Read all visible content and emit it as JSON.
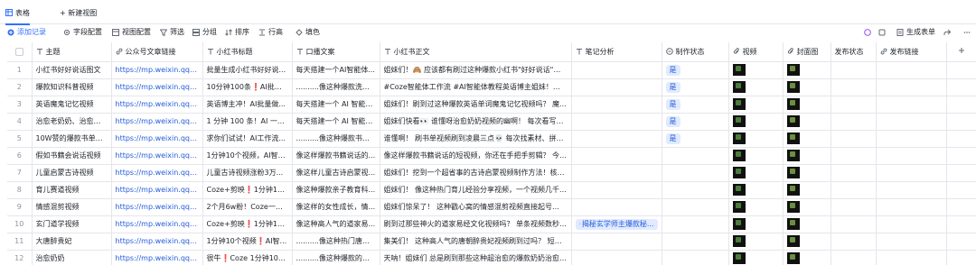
{
  "tabs": {
    "active": "表格",
    "add_view": "+ 新建视图"
  },
  "toolbar": {
    "add_record": "添加记录",
    "field_config": "字段配置",
    "view_config": "视图配置",
    "filter": "筛选",
    "group": "分组",
    "sort": "排序",
    "row_height": "行高",
    "fill_color": "填色",
    "generate_form": "生成表单"
  },
  "columns": [
    "主题",
    "公众号文章链接",
    "小红书标题",
    "口播文案",
    "小红书正文",
    "笔记分析",
    "制作状态",
    "视频",
    "封面图",
    "发布状态",
    "发布链接"
  ],
  "column_icons": [
    "text-icon",
    "link-icon",
    "text-icon",
    "text-icon",
    "text-icon",
    "text-icon",
    "status-icon",
    "attachment-icon",
    "attachment-icon",
    "",
    "link-icon"
  ],
  "rows": [
    {
      "n": "1",
      "topic": "小红书好好说话图文",
      "link": "https://mp.weixin.qq.co...",
      "title": "批量生成小红书好好说...",
      "script": "每天搭建一个AI智能体...",
      "body": "姐妹们！🙈 应该都有刷过这种爆款小红书\"好好说话\"图文...",
      "analysis": "",
      "status": "是",
      "video": "1",
      "cover": "1",
      "pub": "",
      "publink": ""
    },
    {
      "n": "2",
      "topic": "爆款知识科普视频",
      "link": "https://mp.weixin.qq.co...",
      "title": "10分钟100条❗AI批量...",
      "script": "..........像这种爆款洗脑英语...",
      "body": "#Coze智能体工作流 #AI智能体教程英语博主姐妹！！ 着...",
      "analysis": "",
      "status": "是",
      "video": "1",
      "cover": "1",
      "pub": "",
      "publink": ""
    },
    {
      "n": "3",
      "topic": "英语魔鬼记忆视频",
      "link": "https://mp.weixin.qq.co...",
      "title": "英语博主冲！AI批量做...",
      "script": "每天搭建一个 AI 智能体...",
      "body": "姐妹们！刷到过这种爆款英语单词魔鬼记忆视频吗？ 魔...",
      "analysis": "",
      "status": "是",
      "video": "1",
      "cover": "1",
      "pub": "",
      "publink": ""
    },
    {
      "n": "4",
      "topic": "治愈老奶奶、治愈老...",
      "link": "https://mp.weixin.qq.co...",
      "title": "1 分钟 100 条！AI 一键...",
      "script": "每天搭建一个 AI 智能体...",
      "body": "姐妹们快看👀 谁懂呀治愈奶奶视频的幽啊！ 每次看写文...",
      "analysis": "",
      "status": "是",
      "video": "1",
      "cover": "1",
      "pub": "",
      "publink": ""
    },
    {
      "n": "5",
      "topic": "10W赞的爆款书单全...",
      "link": "https://mp.weixin.qq.co...",
      "title": "求你们试试！AI工作流...",
      "script": "..........像这种爆款书单中!...",
      "body": "谁懂啊！ 刷书单视频刷到凌晨三点💀 每次找素材、拼字...",
      "analysis": "",
      "status": "是",
      "video": "1",
      "cover": "1",
      "pub": "",
      "publink": ""
    },
    {
      "n": "6",
      "topic": "假如书籍会说话视频",
      "link": "https://mp.weixin.qq.co...",
      "title": "1分钟10个视频，AI智能...",
      "script": "像这样爆款书籍说话的...",
      "body": "像这样爆款书籍说话的短视频，你还在手把手剪辑？ 今天...",
      "analysis": "",
      "status": "",
      "video": "1",
      "cover": "1",
      "pub": "",
      "publink": ""
    },
    {
      "n": "7",
      "topic": "儿童启蒙古诗视频",
      "link": "https://mp.weixin.qq.co...",
      "title": "儿童古诗视频涨粉3万...",
      "script": "像这样儿童古诗启蒙视...",
      "body": "姐妹们！挖到一个超省事的古诗启蒙视频制作方法！核心...",
      "analysis": "",
      "status": "",
      "video": "1",
      "cover": "1",
      "pub": "",
      "publink": ""
    },
    {
      "n": "8",
      "topic": "育儿赛道视频",
      "link": "https://mp.weixin.qq.co...",
      "title": "Coze+剪映❗1分钟10...",
      "script": "像这种爆款亲子教育科...",
      "body": "姐妹们！ 像这种热门育儿经验分享视频，一个视频几千...",
      "analysis": "",
      "status": "",
      "video": "1",
      "cover": "1",
      "pub": "",
      "publink": ""
    },
    {
      "n": "9",
      "topic": "情感混剪视频",
      "link": "https://mp.weixin.qq.co...",
      "title": "2个月6w粉！Coze一分...",
      "script": "像这样的女性成长，情...",
      "body": "姐妹们惊呆了！ 这种戳心窝的情感混剪视频直接起号...",
      "analysis": "",
      "status": "",
      "video": "1",
      "cover": "1",
      "pub": "",
      "publink": ""
    },
    {
      "n": "10",
      "topic": "玄门道学视频",
      "link": "https://mp.weixin.qq.co...",
      "title": "Coze+剪映❗1分钟10...",
      "script": "像这种高人气的道家易...",
      "body": "刷到过那些神火的道家易经文化视频吗？ 单条视频数秒 5...",
      "analysis": "揭秘玄学师主爆款秘...",
      "status": "",
      "video": "1",
      "cover": "1",
      "pub": "",
      "publink": ""
    },
    {
      "n": "11",
      "topic": "大唐醉贵妃",
      "link": "https://mp.weixin.qq.co...",
      "title": "1分钟10个视频❗AI智...",
      "script": "..........像这种热门唐朝醉驻...",
      "body": "集美们！ 这种高人气的唐朝醉贵妃视频刷到过吗？ 短短几...",
      "analysis": "",
      "status": "",
      "video": "1",
      "cover": "1",
      "pub": "",
      "publink": ""
    },
    {
      "n": "12",
      "topic": "治愈奶奶",
      "link": "https://mp.weixin.qq.co...",
      "title": "很牛❗Coze 1分钟10个...",
      "script": "..........像这种爆款的治愈系...",
      "body": "天呐！姐妹们 总是刷到那些这种超治愈的爆款奶奶治愈系...",
      "analysis": "",
      "status": "",
      "video": "1",
      "cover": "1",
      "pub": "",
      "publink": ""
    }
  ],
  "colors": {
    "accent": "#3370ff",
    "link": "#245bdb",
    "tag_bg": "#e1eaff",
    "border": "#e5e6eb"
  }
}
